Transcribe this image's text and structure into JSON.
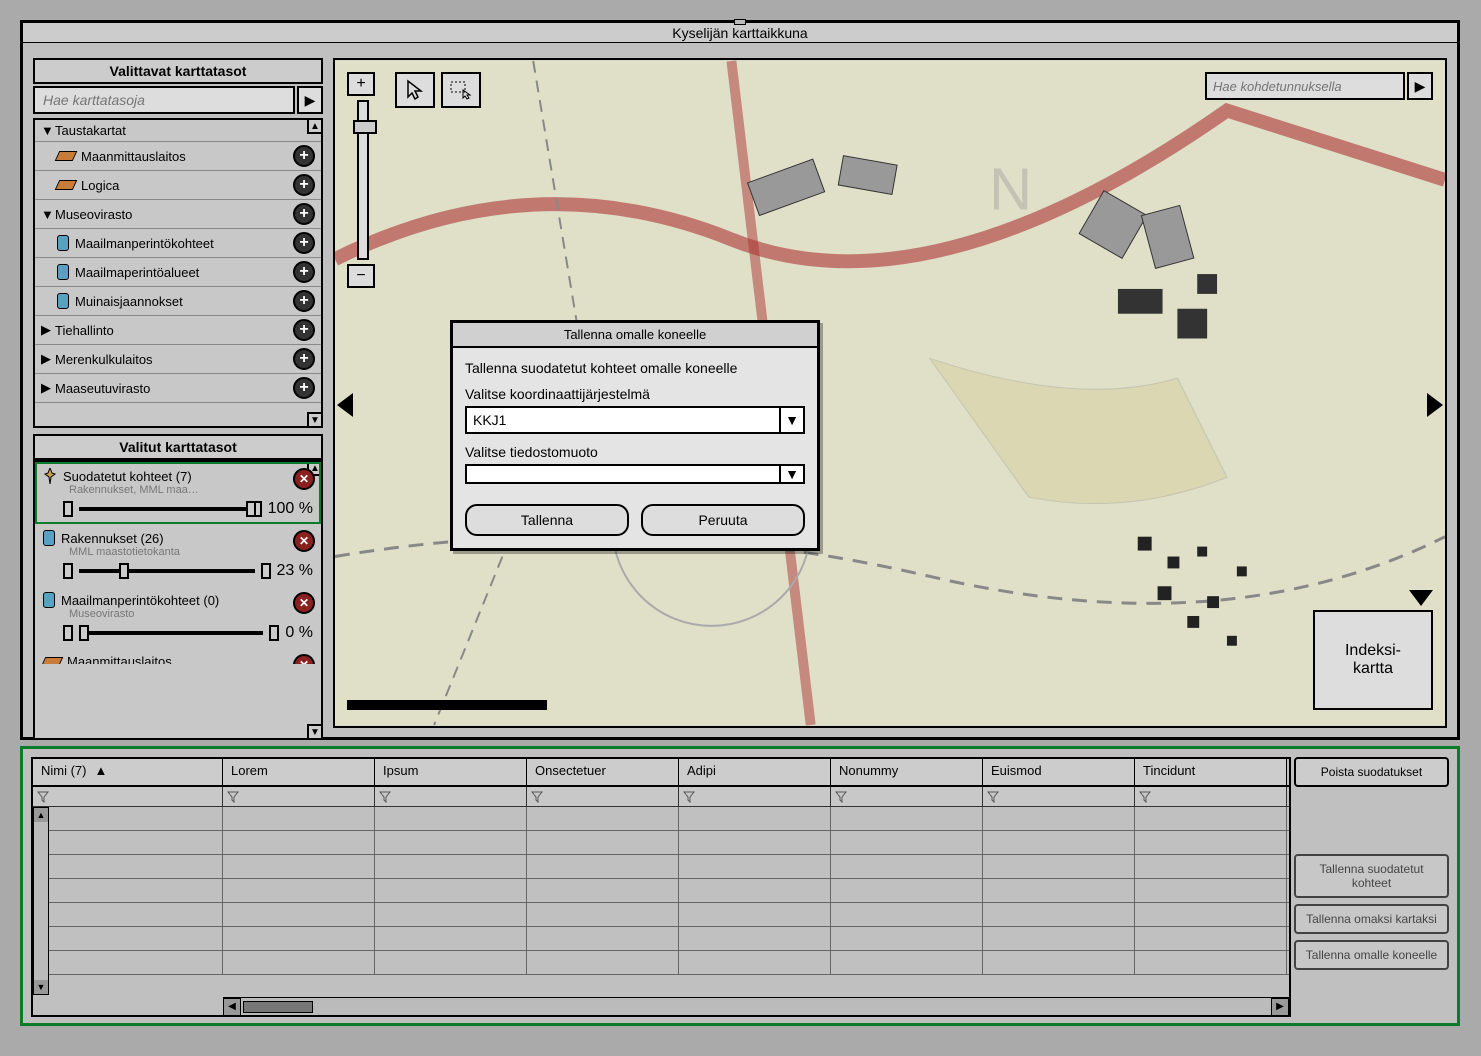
{
  "window": {
    "title": "Kyselijän karttaikkuna"
  },
  "sidebar": {
    "available_title": "Valittavat karttatasot",
    "search_placeholder": "Hae karttatasoja",
    "tree": [
      {
        "label": "Taustakartat",
        "type": "group",
        "expanded": true,
        "children": [
          {
            "label": "Maanmittauslaitos",
            "icon": "orange-layers"
          },
          {
            "label": "Logica",
            "icon": "orange-layers"
          }
        ]
      },
      {
        "label": "Museovirasto",
        "type": "group",
        "expanded": true,
        "addable": true,
        "children": [
          {
            "label": "Maailmanperintökohteet",
            "icon": "blue-cyl"
          },
          {
            "label": "Maailmaperintöalueet",
            "icon": "blue-cyl"
          },
          {
            "label": "Muinaisjaannokset",
            "icon": "blue-cyl"
          }
        ]
      },
      {
        "label": "Tiehallinto",
        "type": "group",
        "expanded": false,
        "addable": true
      },
      {
        "label": "Merenkulkulaitos",
        "type": "group",
        "expanded": false,
        "addable": true
      },
      {
        "label": "Maaseutuvirasto",
        "type": "group",
        "expanded": false,
        "addable": true
      }
    ],
    "selected_title": "Valitut karttatasot",
    "selected": [
      {
        "title": "Suodatetut kohteet (7)",
        "sub": "Rakennukset, MML maa…",
        "opacity": "100 %",
        "pct": 100,
        "highlight": true,
        "icon": "pin"
      },
      {
        "title": "Rakennukset (26)",
        "sub": "MML maastotietokanta",
        "opacity": "23 %",
        "pct": 23,
        "icon": "cyl"
      },
      {
        "title": "Maailmanperintökohteet (0)",
        "sub": "Museovirasto",
        "opacity": "0 %",
        "pct": 0,
        "icon": "cyl"
      },
      {
        "title": "Maanmittauslaitos",
        "sub": "",
        "opacity": "",
        "pct": 0,
        "icon": "orange",
        "cut": true
      }
    ]
  },
  "map": {
    "search_placeholder": "Hae kohdetunnuksella",
    "index_label": "Indeksi-\nkartta"
  },
  "dialog": {
    "title": "Tallenna omalle koneelle",
    "heading": "Tallenna suodatetut kohteet omalle koneelle",
    "crs_label": "Valitse koordinaattijärjestelmä",
    "crs_value": "KKJ1",
    "format_label": "Valitse tiedostomuoto",
    "format_value": "",
    "save": "Tallenna",
    "cancel": "Peruuta"
  },
  "table": {
    "columns": [
      "Nimi (7)",
      "Lorem",
      "Ipsum",
      "Onsectetuer",
      "Adipi",
      "Nonummy",
      "Euismod",
      "Tincidunt"
    ],
    "sort_col": 0,
    "sort_dir": "asc"
  },
  "side_buttons": {
    "clear": "Poista suodatukset",
    "save_filtered": "Tallenna suodatetut kohteet",
    "save_own_map": "Tallenna omaksi kartaksi",
    "save_local": "Tallenna omalle koneelle"
  }
}
